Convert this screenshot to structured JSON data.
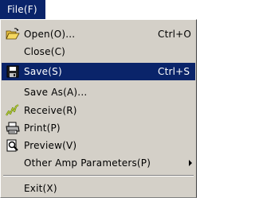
{
  "menubar": {
    "file_label": "File(F)"
  },
  "menu": {
    "items": [
      {
        "label": "Open(O)...",
        "shortcut": "Ctrl+O",
        "icon": "open-folder-icon"
      },
      {
        "label": "Close(C)",
        "shortcut": "",
        "icon": ""
      },
      {
        "label": "Save(S)",
        "shortcut": "Ctrl+S",
        "icon": "save-disk-icon",
        "selected": true
      },
      {
        "label": "Save As(A)...",
        "shortcut": "",
        "icon": ""
      },
      {
        "label": "Receive(R)",
        "shortcut": "",
        "icon": "receive-waveform-icon"
      },
      {
        "label": "Print(P)",
        "shortcut": "",
        "icon": "printer-icon"
      },
      {
        "label": "Preview(V)",
        "shortcut": "",
        "icon": "preview-magnifier-icon"
      },
      {
        "label": "Other Amp Parameters(P)",
        "shortcut": "",
        "icon": "",
        "submenu": true
      },
      {
        "label": "Exit(X)",
        "shortcut": "",
        "icon": ""
      }
    ]
  },
  "colors": {
    "highlight": "#0a246a",
    "menu_background": "#d4d0c8",
    "highlight_text": "#ffffff"
  }
}
